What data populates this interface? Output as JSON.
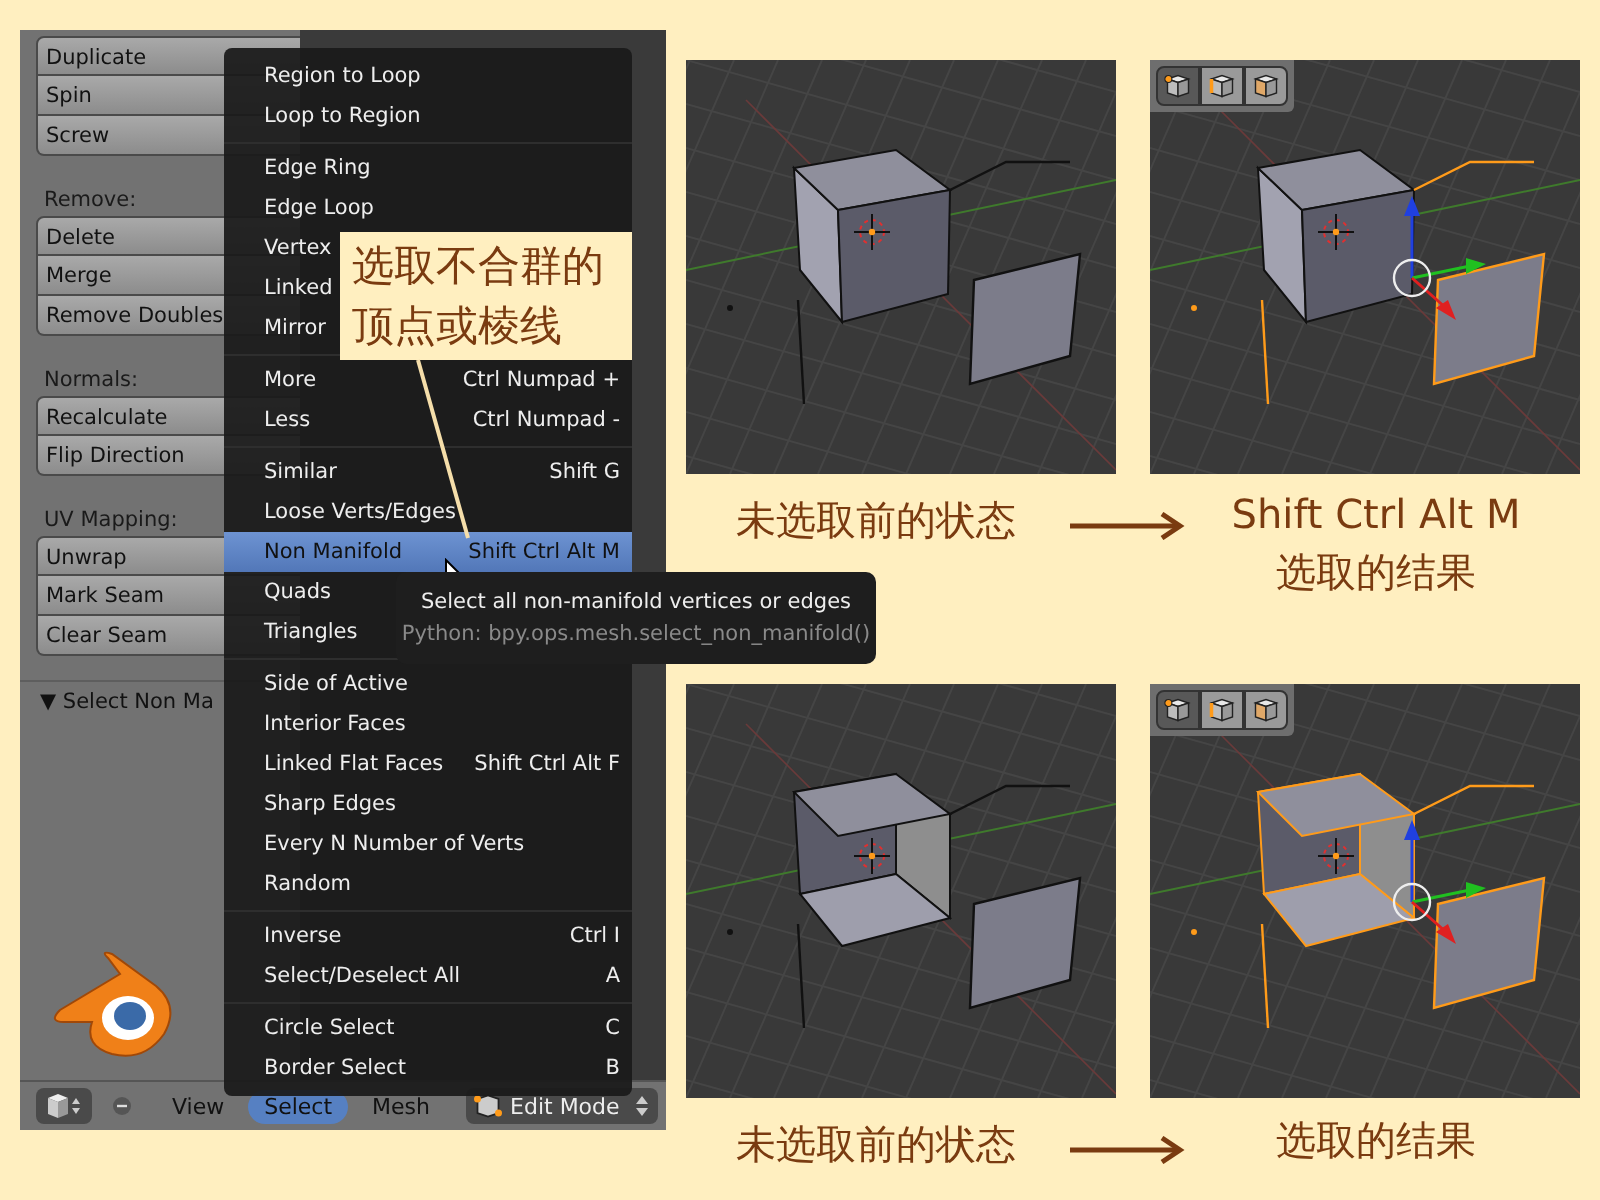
{
  "tool_panel": {
    "groups": [
      {
        "buttons": [
          "Duplicate",
          "Spin",
          "Screw"
        ]
      },
      {
        "label": "Remove:",
        "buttons": [
          "Delete",
          "Merge",
          "Remove Doubles"
        ]
      },
      {
        "label": "Normals:",
        "buttons": [
          "Recalculate",
          "Flip Direction"
        ]
      },
      {
        "label": "UV Mapping:",
        "buttons": [
          "Unwrap",
          "Mark Seam",
          "Clear Seam"
        ]
      }
    ],
    "operator_title": "▼ Select Non Ma"
  },
  "menu": {
    "sections": [
      {
        "items": [
          {
            "label": "Region to Loop",
            "selected": false
          },
          {
            "label": "Loop to Region",
            "selected": false
          }
        ]
      },
      {
        "items": [
          {
            "label": "Edge Ring",
            "selected": false
          },
          {
            "label": "Edge Loop",
            "selected": false
          },
          {
            "label": "Vertex",
            "selected": false
          },
          {
            "label": "Linked",
            "selected": false
          },
          {
            "label": "Mirror",
            "selected": false
          }
        ]
      },
      {
        "items": [
          {
            "label": "More",
            "shortcut": "Ctrl Numpad +",
            "selected": false
          },
          {
            "label": "Less",
            "shortcut": "Ctrl Numpad -",
            "selected": false
          }
        ]
      },
      {
        "items": [
          {
            "label": "Similar",
            "shortcut": "Shift G",
            "selected": false
          },
          {
            "label": "Loose Verts/Edges",
            "selected": false
          },
          {
            "label": "Non Manifold",
            "shortcut": "Shift Ctrl Alt M",
            "selected": true
          },
          {
            "label": "Quads",
            "selected": false
          },
          {
            "label": "Triangles",
            "selected": false
          }
        ]
      },
      {
        "items": [
          {
            "label": "Side of Active",
            "selected": false
          },
          {
            "label": "Interior Faces",
            "selected": false
          },
          {
            "label": "Linked Flat Faces",
            "shortcut": "Shift Ctrl Alt F",
            "selected": false
          },
          {
            "label": "Sharp Edges",
            "selected": false
          },
          {
            "label": "Every N Number of Verts",
            "selected": false
          },
          {
            "label": "Random",
            "selected": false
          }
        ]
      },
      {
        "items": [
          {
            "label": "Inverse",
            "shortcut": "Ctrl I",
            "selected": false
          },
          {
            "label": "Select/Deselect All",
            "shortcut": "A",
            "selected": false
          }
        ]
      },
      {
        "items": [
          {
            "label": "Circle Select",
            "shortcut": "C",
            "selected": false
          },
          {
            "label": "Border Select",
            "shortcut": "B",
            "selected": false
          }
        ]
      }
    ]
  },
  "tooltip": {
    "description": "Select all non-manifold vertices or edges",
    "python": "Python: bpy.ops.mesh.select_non_manifold()"
  },
  "callout": {
    "lines": [
      "选取不合群的",
      "顶点或棱线"
    ]
  },
  "header": {
    "menus": [
      {
        "label": "View",
        "selected": false
      },
      {
        "label": "Select",
        "selected": true
      },
      {
        "label": "Mesh",
        "selected": false
      }
    ],
    "mode": "Edit Mode"
  },
  "comparisons": [
    {
      "kind": "closed_cube",
      "before_caption": "未选取前的状态",
      "after_caption_lines": [
        "Shift Ctrl Alt M",
        "选取的结果"
      ],
      "select_modes": [
        {
          "selected": true
        },
        {
          "selected": false
        },
        {
          "selected": false
        }
      ]
    },
    {
      "kind": "open_cube",
      "before_caption": "未选取前的状态",
      "after_caption_lines": [
        "选取的结果"
      ],
      "select_modes": [
        {
          "selected": true
        },
        {
          "selected": false
        },
        {
          "selected": false
        }
      ]
    }
  ]
}
